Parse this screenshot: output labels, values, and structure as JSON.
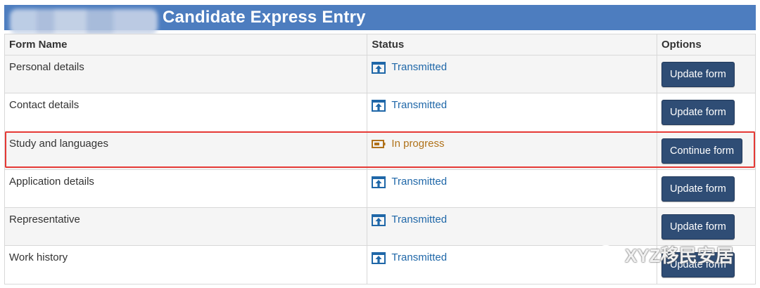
{
  "header": {
    "title": "Candidate Express Entry"
  },
  "table": {
    "headers": {
      "name": "Form Name",
      "status": "Status",
      "options": "Options"
    },
    "rows": [
      {
        "name": "Personal details",
        "status": "Transmitted",
        "status_type": "transmitted",
        "action": "Update form"
      },
      {
        "name": "Contact details",
        "status": "Transmitted",
        "status_type": "transmitted",
        "action": "Update form"
      },
      {
        "name": "Study and languages",
        "status": "In progress",
        "status_type": "in-progress",
        "action": "Continue form"
      },
      {
        "name": "Application details",
        "status": "Transmitted",
        "status_type": "transmitted",
        "action": "Update form"
      },
      {
        "name": "Representative",
        "status": "Transmitted",
        "status_type": "transmitted",
        "action": "Update form"
      },
      {
        "name": "Work history",
        "status": "Transmitted",
        "status_type": "transmitted",
        "action": "Update form"
      }
    ]
  },
  "icons": {
    "transmitted": "upload-arrow-icon",
    "in_progress": "progress-battery-icon"
  },
  "colors": {
    "header_bg": "#4d7dbf",
    "transmitted": "#1f67a8",
    "in_progress": "#b0721a",
    "button": "#2f4d75",
    "highlight": "#e53935"
  },
  "watermark": {
    "text": "XYZ移民安居"
  }
}
